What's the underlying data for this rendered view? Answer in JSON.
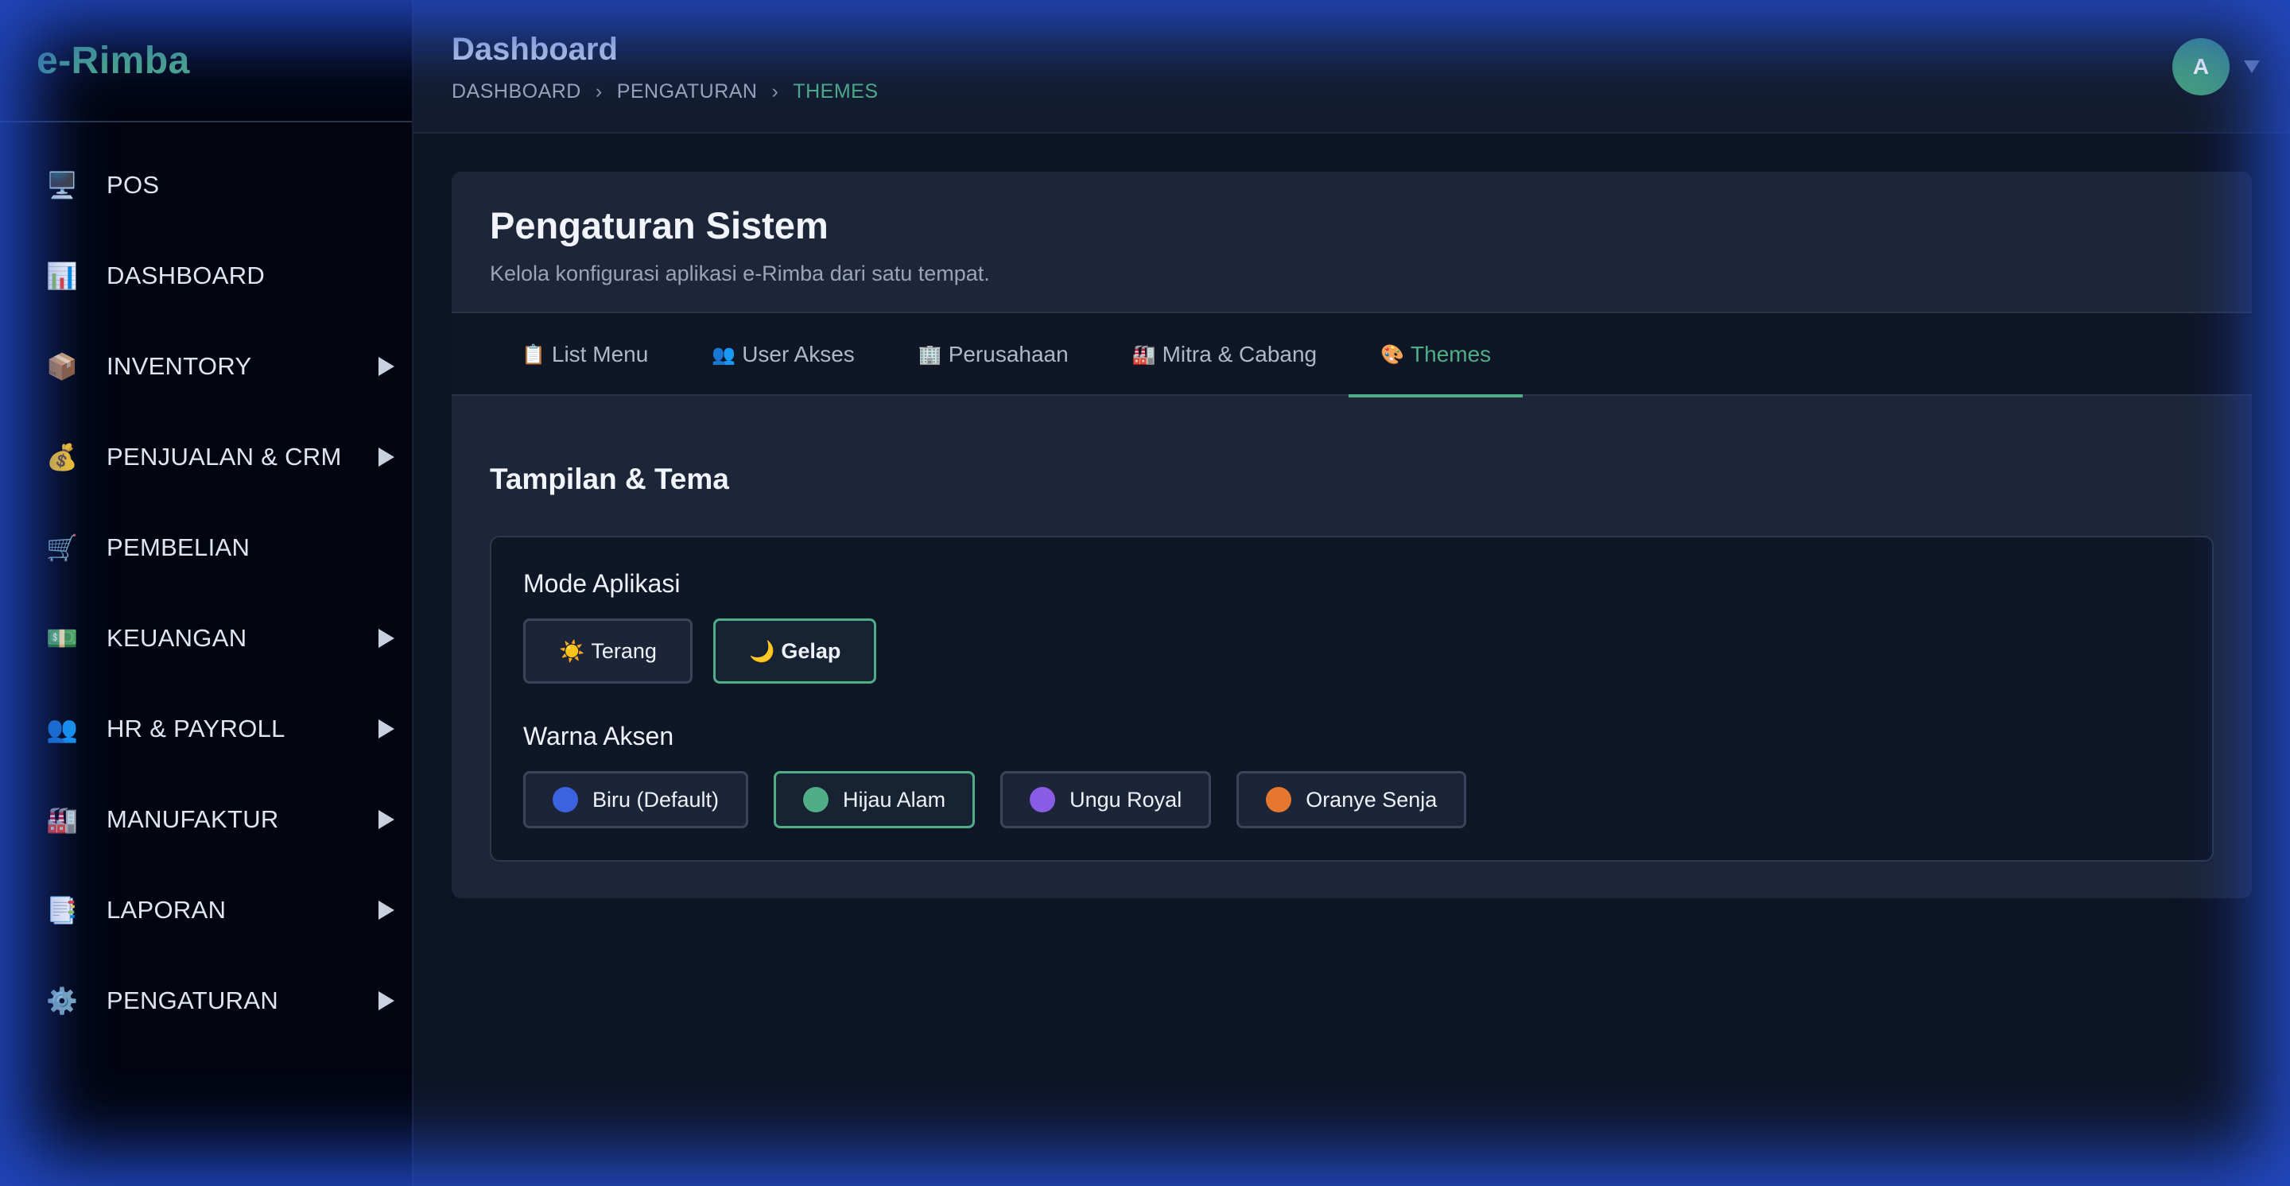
{
  "brand": {
    "name": "e-Rimba",
    "color": "#4fae87"
  },
  "sidebar": {
    "items": [
      {
        "label": "POS",
        "icon": "🖥️",
        "icon_name": "computer-icon",
        "has_submenu": false
      },
      {
        "label": "DASHBOARD",
        "icon": "📊",
        "icon_name": "chart-icon",
        "has_submenu": false
      },
      {
        "label": "INVENTORY",
        "icon": "📦",
        "icon_name": "package-icon",
        "has_submenu": true
      },
      {
        "label": "PENJUALAN & CRM",
        "icon": "💰",
        "icon_name": "money-bag-icon",
        "has_submenu": true
      },
      {
        "label": "PEMBELIAN",
        "icon": "🛒",
        "icon_name": "cart-icon",
        "has_submenu": false
      },
      {
        "label": "KEUANGAN",
        "icon": "💵",
        "icon_name": "cash-icon",
        "has_submenu": true
      },
      {
        "label": "HR & PAYROLL",
        "icon": "👥",
        "icon_name": "users-icon",
        "has_submenu": true
      },
      {
        "label": "MANUFAKTUR",
        "icon": "🏭",
        "icon_name": "factory-icon",
        "has_submenu": true
      },
      {
        "label": "LAPORAN",
        "icon": "📑",
        "icon_name": "report-icon",
        "has_submenu": true
      },
      {
        "label": "PENGATURAN",
        "icon": "⚙️",
        "icon_name": "gear-icon",
        "has_submenu": true
      }
    ]
  },
  "header": {
    "title": "Dashboard",
    "breadcrumb": [
      "DASHBOARD",
      "PENGATURAN",
      "THEMES"
    ],
    "separator": "›",
    "avatar_initial": "A"
  },
  "card": {
    "title": "Pengaturan Sistem",
    "subtitle": "Kelola konfigurasi aplikasi e-Rimba dari satu tempat."
  },
  "tabs": [
    {
      "label": "List Menu",
      "icon": "📋",
      "icon_name": "clipboard-icon",
      "active": false
    },
    {
      "label": "User Akses",
      "icon": "👥",
      "icon_name": "users-icon",
      "active": false
    },
    {
      "label": "Perusahaan",
      "icon": "🏢",
      "icon_name": "building-icon",
      "active": false
    },
    {
      "label": "Mitra & Cabang",
      "icon": "🏭",
      "icon_name": "factory-icon",
      "active": false
    },
    {
      "label": "Themes",
      "icon": "🎨",
      "icon_name": "palette-icon",
      "active": true
    }
  ],
  "themes": {
    "section_title": "Tampilan & Tema",
    "mode_label": "Mode Aplikasi",
    "modes": [
      {
        "label": "Terang",
        "icon": "☀️",
        "icon_name": "sun-icon",
        "selected": false
      },
      {
        "label": "Gelap",
        "icon": "🌙",
        "icon_name": "moon-icon",
        "selected": true
      }
    ],
    "accent_label": "Warna Aksen",
    "accents": [
      {
        "label": "Biru (Default)",
        "color": "#3b63e0",
        "selected": false
      },
      {
        "label": "Hijau Alam",
        "color": "#4fae87",
        "selected": true
      },
      {
        "label": "Ungu Royal",
        "color": "#8a5ce6",
        "selected": false
      },
      {
        "label": "Oranye Senja",
        "color": "#e6772e",
        "selected": false
      }
    ]
  }
}
